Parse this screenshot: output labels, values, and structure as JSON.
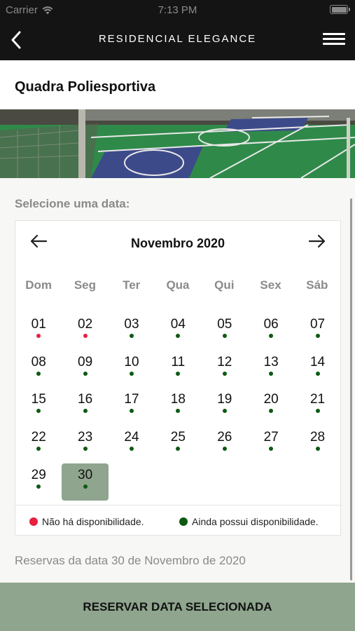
{
  "status_bar": {
    "carrier": "Carrier",
    "time": "7:13 PM"
  },
  "nav": {
    "title": "RESIDENCIAL ELEGANCE",
    "back_icon": "chevron-left-icon",
    "menu_icon": "hamburger-menu-icon"
  },
  "page": {
    "title": "Quadra Poliesportiva"
  },
  "calendar": {
    "prompt": "Selecione uma data:",
    "month_label": "Novembro 2020",
    "weekdays": [
      "Dom",
      "Seg",
      "Ter",
      "Qua",
      "Qui",
      "Sex",
      "Sáb"
    ],
    "days": [
      {
        "n": "01",
        "status": "unavailable"
      },
      {
        "n": "02",
        "status": "unavailable"
      },
      {
        "n": "03",
        "status": "available"
      },
      {
        "n": "04",
        "status": "available"
      },
      {
        "n": "05",
        "status": "available"
      },
      {
        "n": "06",
        "status": "available"
      },
      {
        "n": "07",
        "status": "available"
      },
      {
        "n": "08",
        "status": "available"
      },
      {
        "n": "09",
        "status": "available"
      },
      {
        "n": "10",
        "status": "available"
      },
      {
        "n": "11",
        "status": "available"
      },
      {
        "n": "12",
        "status": "available"
      },
      {
        "n": "13",
        "status": "available"
      },
      {
        "n": "14",
        "status": "available"
      },
      {
        "n": "15",
        "status": "available"
      },
      {
        "n": "16",
        "status": "available"
      },
      {
        "n": "17",
        "status": "available"
      },
      {
        "n": "18",
        "status": "available"
      },
      {
        "n": "19",
        "status": "available"
      },
      {
        "n": "20",
        "status": "available"
      },
      {
        "n": "21",
        "status": "available"
      },
      {
        "n": "22",
        "status": "available"
      },
      {
        "n": "23",
        "status": "available"
      },
      {
        "n": "24",
        "status": "available"
      },
      {
        "n": "25",
        "status": "available"
      },
      {
        "n": "26",
        "status": "available"
      },
      {
        "n": "27",
        "status": "available"
      },
      {
        "n": "28",
        "status": "available"
      },
      {
        "n": "29",
        "status": "available"
      },
      {
        "n": "30",
        "status": "available",
        "selected": true
      }
    ],
    "legend": {
      "unavailable": "Não há disponibilidade.",
      "available": "Ainda possui disponibilidade."
    },
    "colors": {
      "unavailable": "#e8213f",
      "available": "#0d5a12",
      "selected_bg": "#8fa58e"
    }
  },
  "reservations_label": "Reservas da data 30 de Novembro de 2020",
  "cta_label": "RESERVAR DATA SELECIONADA"
}
